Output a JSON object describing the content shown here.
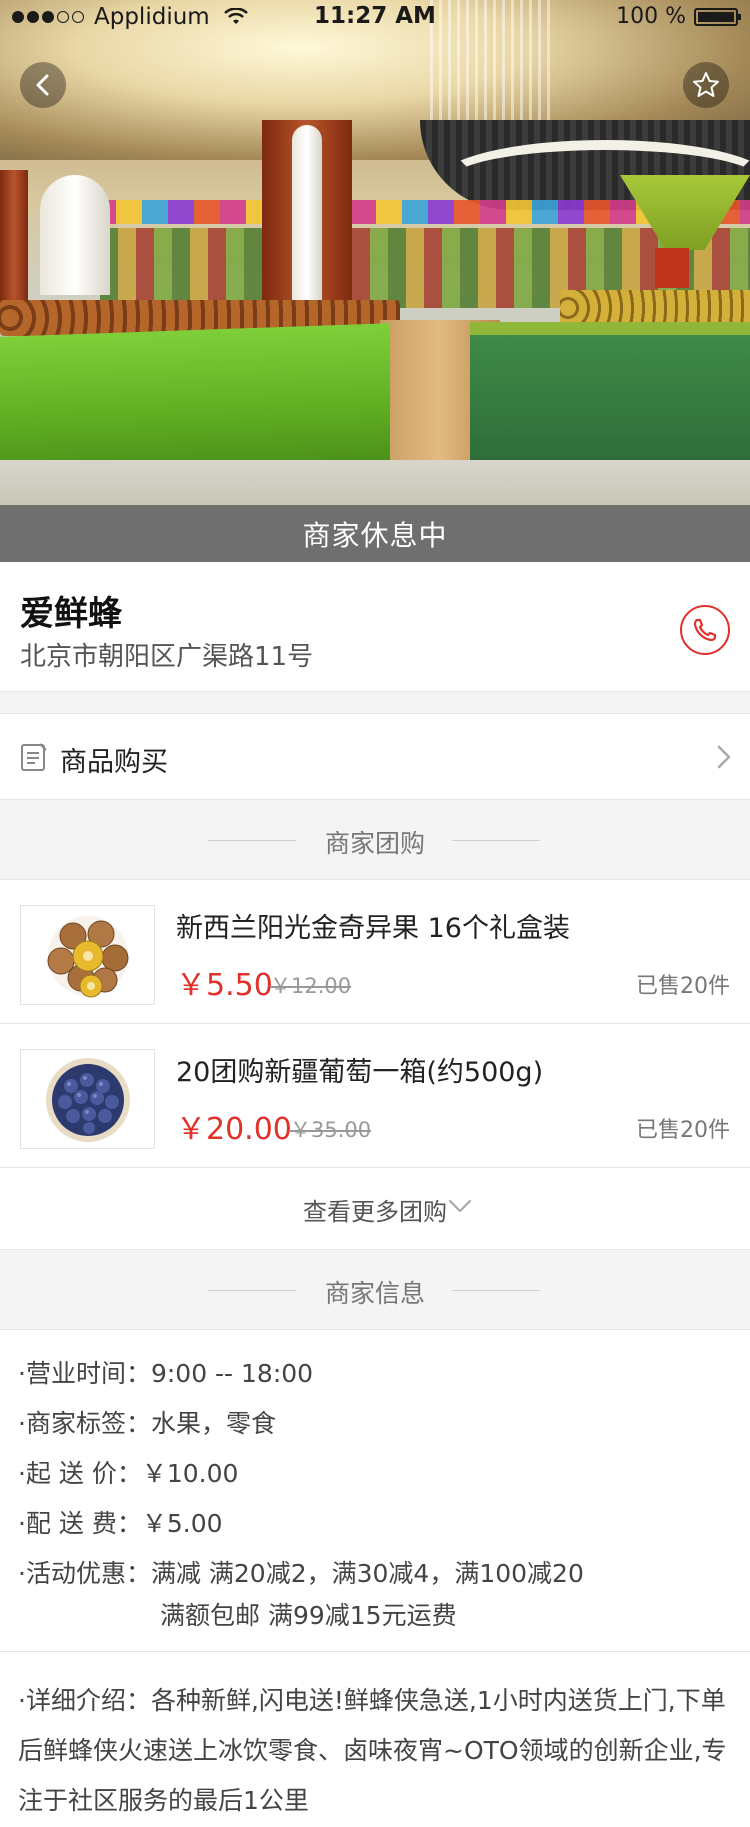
{
  "status_bar": {
    "carrier": "Applidium",
    "time": "11:27 AM",
    "battery": "100 %"
  },
  "hero": {
    "closed_notice": "商家休息中"
  },
  "shop": {
    "name": "爱鲜蜂",
    "address": "北京市朝阳区广渠路11号"
  },
  "buy": {
    "label": "商品购买"
  },
  "group_section": {
    "title": "商家团购"
  },
  "deals": [
    {
      "title": "新西兰阳光金奇异果 16个礼盒装",
      "price": "￥5.50",
      "old_price": "￥12.00",
      "sold": "已售20件"
    },
    {
      "title": "20团购新疆葡萄一箱(约500g)",
      "price": "￥20.00",
      "old_price": "￥35.00",
      "sold": "已售20件"
    }
  ],
  "more": {
    "label": "查看更多团购"
  },
  "info_section": {
    "title": "商家信息"
  },
  "info": {
    "hours_key": "·营业时间：",
    "hours_val": "9:00 -- 18:00",
    "tags_key": "·商家标签：",
    "tags_val": "水果，零食",
    "min_key": "·起  送  价：",
    "min_val": "￥10.00",
    "fee_key": "·配  送  费：",
    "fee_val": "￥5.00",
    "promo_key": "·活动优惠：",
    "promo_val": "满减 满20减2，满30减4，满100减20",
    "promo_val2": "满额包邮 满99减15元运费"
  },
  "detail": {
    "text": "·详细介绍：各种新鲜,闪电送!鲜蜂侠急送,1小时内送货上门,下单后鲜蜂侠火速送上冰饮零食、卤味夜宵~OTO领域的创新企业,专注于社区服务的最后1公里"
  },
  "colors": {
    "accent_red": "#e0312a",
    "closed_bar": "#6f6f6f",
    "section_bg": "#f4f4f4"
  }
}
